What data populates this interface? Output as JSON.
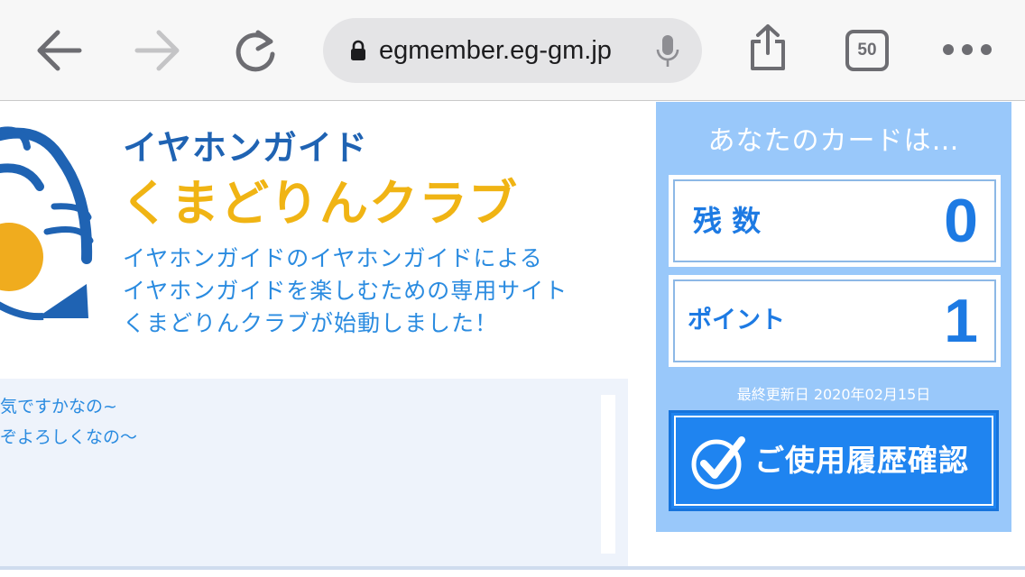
{
  "browser": {
    "url": "egmember.eg-gm.jp",
    "tab_count": "50",
    "icons": {
      "back": "arrow-left-icon",
      "forward": "arrow-right-icon",
      "reload": "reload-icon",
      "lock": "lock-icon",
      "mic": "microphone-icon",
      "share": "share-icon",
      "tabs": "tabs-icon",
      "more": "more-icon"
    }
  },
  "site": {
    "brand_line1": "イヤホンガイド",
    "brand_line2": "くまどりんクラブ",
    "intro_lines": [
      "イヤホンガイドのイヤホンガイドによる",
      "イヤホンガイドを楽しむための専用サイト",
      "くまどりんクラブが始動しました！"
    ],
    "news_lines": [
      "気ですかなの~",
      "ぞよろしくなの～"
    ]
  },
  "card": {
    "heading": "あなたのカードは…",
    "balance_label": "残 数",
    "balance_value": "0",
    "points_label": "ポイント",
    "points_value": "1",
    "updated": "最終更新日 2020年02月15日",
    "history_button": "ご使用履歴確認"
  },
  "colors": {
    "brand_blue": "#1f63b3",
    "brand_yellow": "#f0b414",
    "link_blue": "#2a8be0",
    "card_panel": "#99c8fa",
    "value_blue": "#1d7ae3",
    "button_blue": "#1f84f0"
  }
}
